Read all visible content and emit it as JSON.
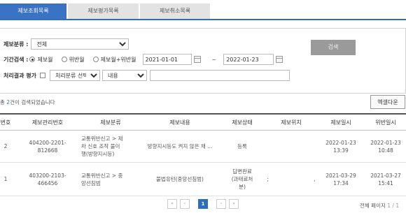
{
  "tabs": [
    {
      "label": "제보조회목록",
      "active": true
    },
    {
      "label": "제보평가목록",
      "active": false
    },
    {
      "label": "제보취소목록",
      "active": false
    }
  ],
  "filters": {
    "category_label": "제보분류 :",
    "category_value": "전체",
    "period_label": "기간검색 :",
    "period_options": [
      "제보월",
      "위반월",
      "제보월+위반월"
    ],
    "period_selected": "제보월",
    "date_from": "2021-01-01",
    "date_sep": "~",
    "date_to": "2022-01-23",
    "process_label": "처리결과 평가",
    "process_select_value": "처리분류 선택",
    "content_select_value": "내용",
    "keyword_value": "",
    "search_button": "검색"
  },
  "results": {
    "count_prefix": "총 ",
    "count_value": "2",
    "count_suffix": "건이 검색되었습니다",
    "excel_button": "엑셀다운"
  },
  "table": {
    "headers": [
      "번호",
      "제보관리번호",
      "제보분류",
      "제보내용",
      "제보상태",
      "제보위치",
      "제보일시",
      "위반일시"
    ],
    "rows": [
      {
        "no": "2",
        "manage_no_1": "404200-2201-",
        "manage_no_2": "812668",
        "category_1": "교통위반신고 > 제",
        "category_2": "차 신호 조작 불이",
        "category_3": "행(방향지시등)",
        "content": "방향지시등도 켜지 않은 채 ...",
        "status_1": "등록",
        "status_2": "",
        "status_3": "",
        "location": "",
        "location_tail": "",
        "report_date": "2022-01-23",
        "report_time": "13:39",
        "violation_date": "2022-01-23",
        "violation_time": "10:48"
      },
      {
        "no": "1",
        "manage_no_1": "403200-2103-",
        "manage_no_2": "466456",
        "category_1": "교통위반신고 > 중",
        "category_2": "앙선침범",
        "category_3": "",
        "content": "불법유턴(중앙선침범)",
        "status_1": "답변완료",
        "status_2": "(과태료처",
        "status_3": "분)",
        "location": ";",
        "location_tail": ",",
        "report_date": "2021-03-29",
        "report_time": "17:34",
        "violation_date": "2021-03-27",
        "violation_time": "15:41"
      }
    ]
  },
  "pagination": {
    "first": "«",
    "prev": "‹",
    "current": "1",
    "next": "›",
    "last": "»",
    "info_label": "전체 페이지",
    "info_value": "1 / 1"
  },
  "colors": {
    "accent": "#3b73c4",
    "tab_inactive": "#e3e3e3",
    "search_button": "#9a9a9a"
  }
}
